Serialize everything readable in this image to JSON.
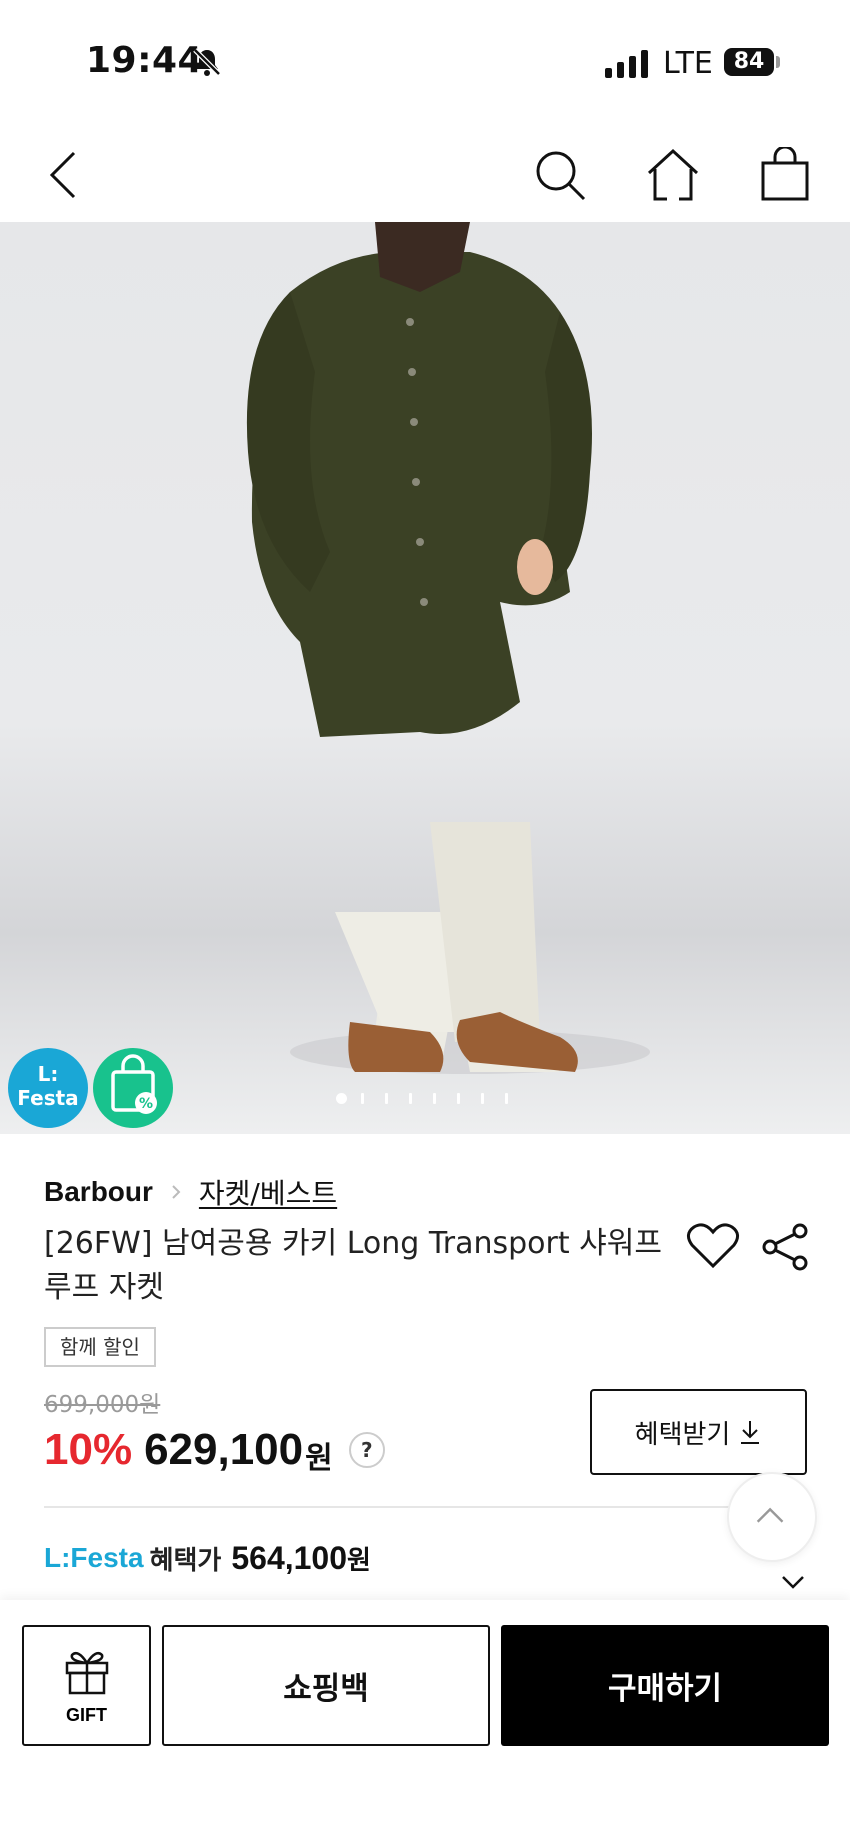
{
  "status": {
    "time": "19:44",
    "network": "LTE",
    "battery": "84"
  },
  "icons": {
    "bell_off": "bell-off-icon",
    "signal": "signal-icon",
    "back": "chevron-left-icon",
    "search": "search-icon",
    "home": "home-icon",
    "cart": "shopping-bag-icon",
    "wish": "heart-icon",
    "share": "share-icon",
    "download": "download-icon",
    "scroll_top": "chevron-up-icon",
    "expand": "chevron-down-icon",
    "gift": "gift-icon",
    "coupon": "coupon-bag-icon"
  },
  "hero": {
    "badge_festa": "L:\nFesta",
    "image_count": 8,
    "current_image": 1
  },
  "product": {
    "brand": "Barbour",
    "category": "자켓/베스트",
    "title": "[26FW] 남여공용 카키 Long Transport 샤워프루프 자켓",
    "tag": "함께 할인",
    "original_price": "699,000원",
    "discount": "10%",
    "price": "629,100",
    "price_unit": "원",
    "help": "?"
  },
  "benefit_button": {
    "label": "혜택받기"
  },
  "festa": {
    "logo": "L:Festa",
    "label": "혜택가",
    "price": "564,100",
    "unit": "원"
  },
  "bottom_bar": {
    "gift_label": "GIFT",
    "bag_label": "쇼핑백",
    "buy_label": "구매하기"
  },
  "colors": {
    "discount_red": "#e6282f",
    "festa_blue": "#1aa7d6",
    "coupon_green": "#18c28d",
    "buy_black": "#000000"
  }
}
